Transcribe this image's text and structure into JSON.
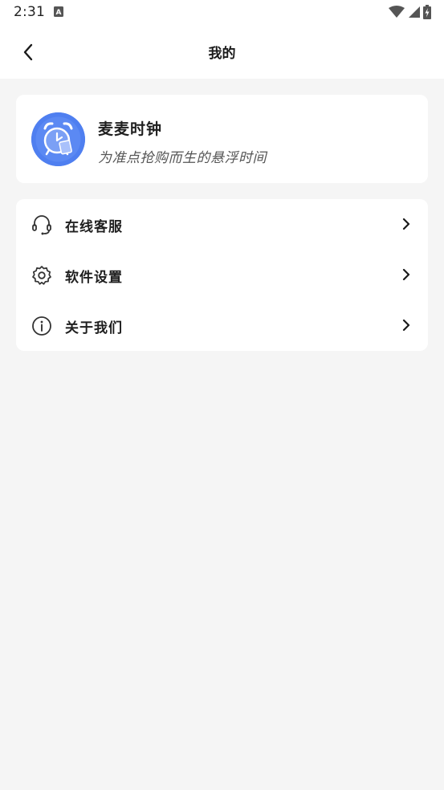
{
  "status_bar": {
    "time": "2:31",
    "app_icon_letter": "A",
    "icons": [
      "wifi-icon",
      "cellular-signal-icon",
      "battery-charging-icon"
    ]
  },
  "header": {
    "title": "我的",
    "back_icon": "chevron-left-icon"
  },
  "profile": {
    "app_name": "麦麦时钟",
    "slogan": "为准点抢购而生的悬浮时间",
    "avatar_icon": "alarm-clock-icon",
    "avatar_color": "#4f7ff0"
  },
  "menu": {
    "items": [
      {
        "label": "在线客服",
        "icon": "headset-icon"
      },
      {
        "label": "软件设置",
        "icon": "gear-icon"
      },
      {
        "label": "关于我们",
        "icon": "info-icon"
      }
    ],
    "chevron_icon": "chevron-right-icon"
  },
  "colors": {
    "background": "#f5f5f5",
    "card": "#ffffff",
    "accent": "#4f7ff0",
    "text": "#1f1f1f"
  }
}
